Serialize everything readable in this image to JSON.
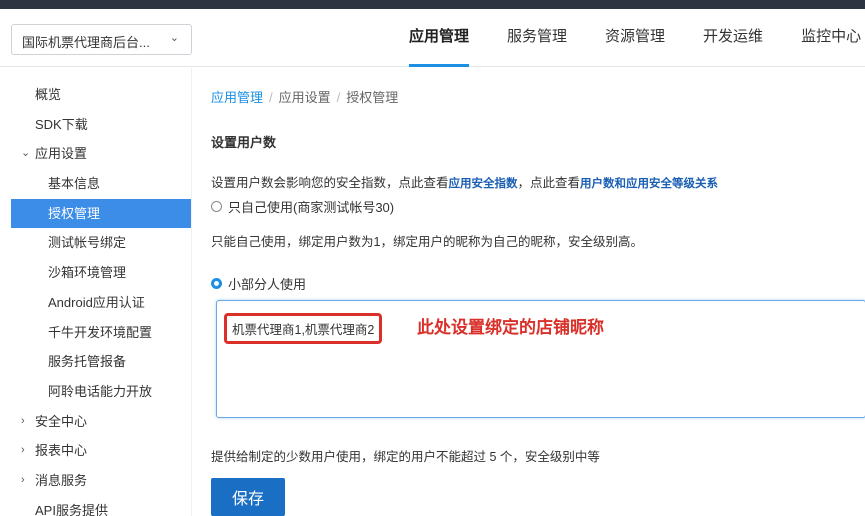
{
  "header": {
    "app_select_value": "国际机票代理商后台...",
    "nav": [
      "应用管理",
      "服务管理",
      "资源管理",
      "开发运维",
      "监控中心"
    ]
  },
  "sidebar": {
    "items": [
      {
        "label": "概览"
      },
      {
        "label": "SDK下载"
      },
      {
        "label": "应用设置"
      },
      {
        "label": "基本信息"
      },
      {
        "label": "授权管理"
      },
      {
        "label": "测试帐号绑定"
      },
      {
        "label": "沙箱环境管理"
      },
      {
        "label": "Android应用认证"
      },
      {
        "label": "千牛开发环境配置"
      },
      {
        "label": "服务托管报备"
      },
      {
        "label": "阿聆电话能力开放"
      },
      {
        "label": "安全中心"
      },
      {
        "label": "报表中心"
      },
      {
        "label": "消息服务"
      },
      {
        "label": "API服务提供"
      }
    ]
  },
  "breadcrumb": [
    "应用管理",
    "应用设置",
    "授权管理"
  ],
  "main": {
    "section_title": "设置用户数",
    "desc_prefix": "设置用户数会影响您的安全指数，点此查看",
    "desc_link1": "应用安全指数",
    "desc_mid": "，点此查看",
    "desc_link2": "用户数和应用安全等级关系",
    "option1_label": "只自己使用(商家测试帐号30)",
    "option1_note": "只能自己使用，绑定用户数为1，绑定用户的昵称为自己的昵称，安全级别高。",
    "option2_label": "小部分人使用",
    "textarea_value": "机票代理商1,机票代理商2",
    "annotation": "此处设置绑定的店铺昵称",
    "option2_note": "提供给制定的少数用户使用，绑定的用户不能超过 5 个，安全级别中等",
    "save_label": "保存"
  }
}
